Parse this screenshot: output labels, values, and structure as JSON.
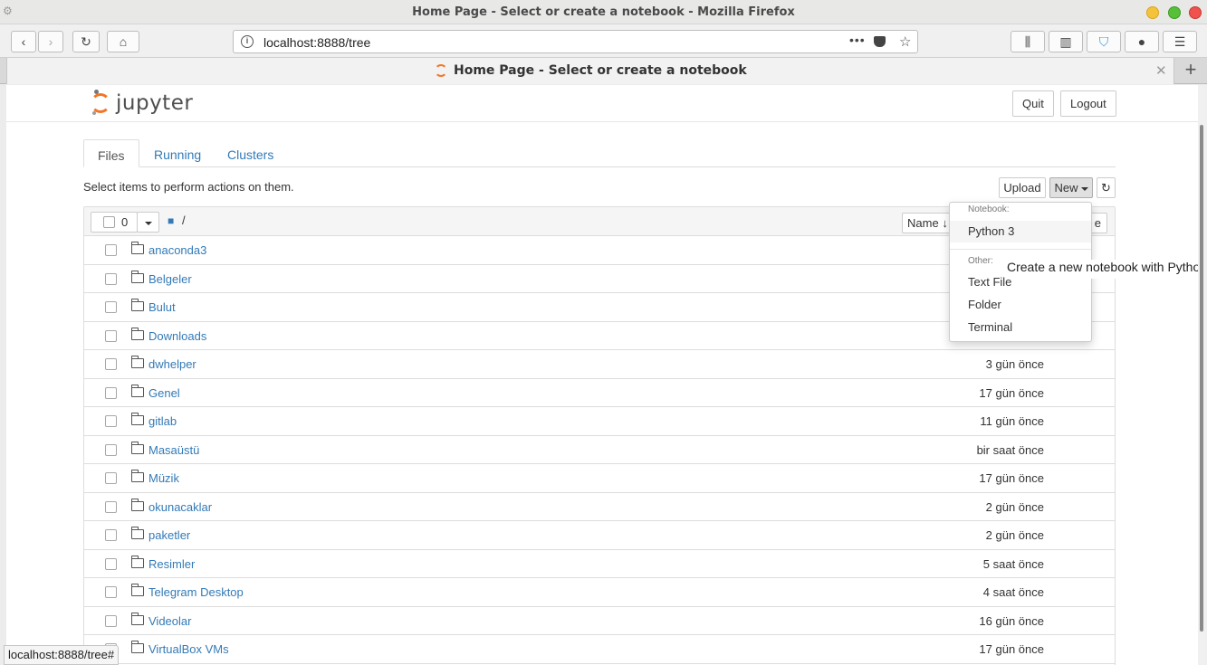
{
  "window": {
    "title": "Home Page - Select or create a notebook - Mozilla Firefox"
  },
  "browser": {
    "url": "localhost:8888/tree",
    "tab_title": "Home Page - Select or create a notebook",
    "status_url": "localhost:8888/tree#",
    "page_actions_label": "•••"
  },
  "jupyter": {
    "logo_text": "jupyter",
    "quit_label": "Quit",
    "logout_label": "Logout",
    "tabs": [
      {
        "label": "Files"
      },
      {
        "label": "Running"
      },
      {
        "label": "Clusters"
      }
    ],
    "select_hint": "Select items to perform actions on them.",
    "upload_label": "Upload",
    "new_label": "New",
    "selected_count": "0",
    "breadcrumb": "/",
    "sort_label": "Name",
    "modified_label_partial": "e"
  },
  "new_menu": {
    "notebook_header": "Notebook:",
    "python_label": "Python 3",
    "other_header": "Other:",
    "text_file_label": "Text File",
    "folder_label": "Folder",
    "terminal_label": "Terminal",
    "tooltip": "Create a new notebook with Pytho"
  },
  "files": [
    {
      "name": "anaconda3",
      "modified": ""
    },
    {
      "name": "Belgeler",
      "modified": ""
    },
    {
      "name": "Bulut",
      "modified": ""
    },
    {
      "name": "Downloads",
      "modified": ""
    },
    {
      "name": "dwhelper",
      "modified": "3 gün önce"
    },
    {
      "name": "Genel",
      "modified": "17 gün önce"
    },
    {
      "name": "gitlab",
      "modified": "11 gün önce"
    },
    {
      "name": "Masaüstü",
      "modified": "bir saat önce"
    },
    {
      "name": "Müzik",
      "modified": "17 gün önce"
    },
    {
      "name": "okunacaklar",
      "modified": "2 gün önce"
    },
    {
      "name": "paketler",
      "modified": "2 gün önce"
    },
    {
      "name": "Resimler",
      "modified": "5 saat önce"
    },
    {
      "name": "Telegram Desktop",
      "modified": "4 saat önce"
    },
    {
      "name": "Videolar",
      "modified": "16 gün önce"
    },
    {
      "name": "VirtualBox VMs",
      "modified": "17 gün önce"
    }
  ],
  "colors": {
    "link": "#337ab7",
    "jupyter_orange": "#f37626"
  }
}
